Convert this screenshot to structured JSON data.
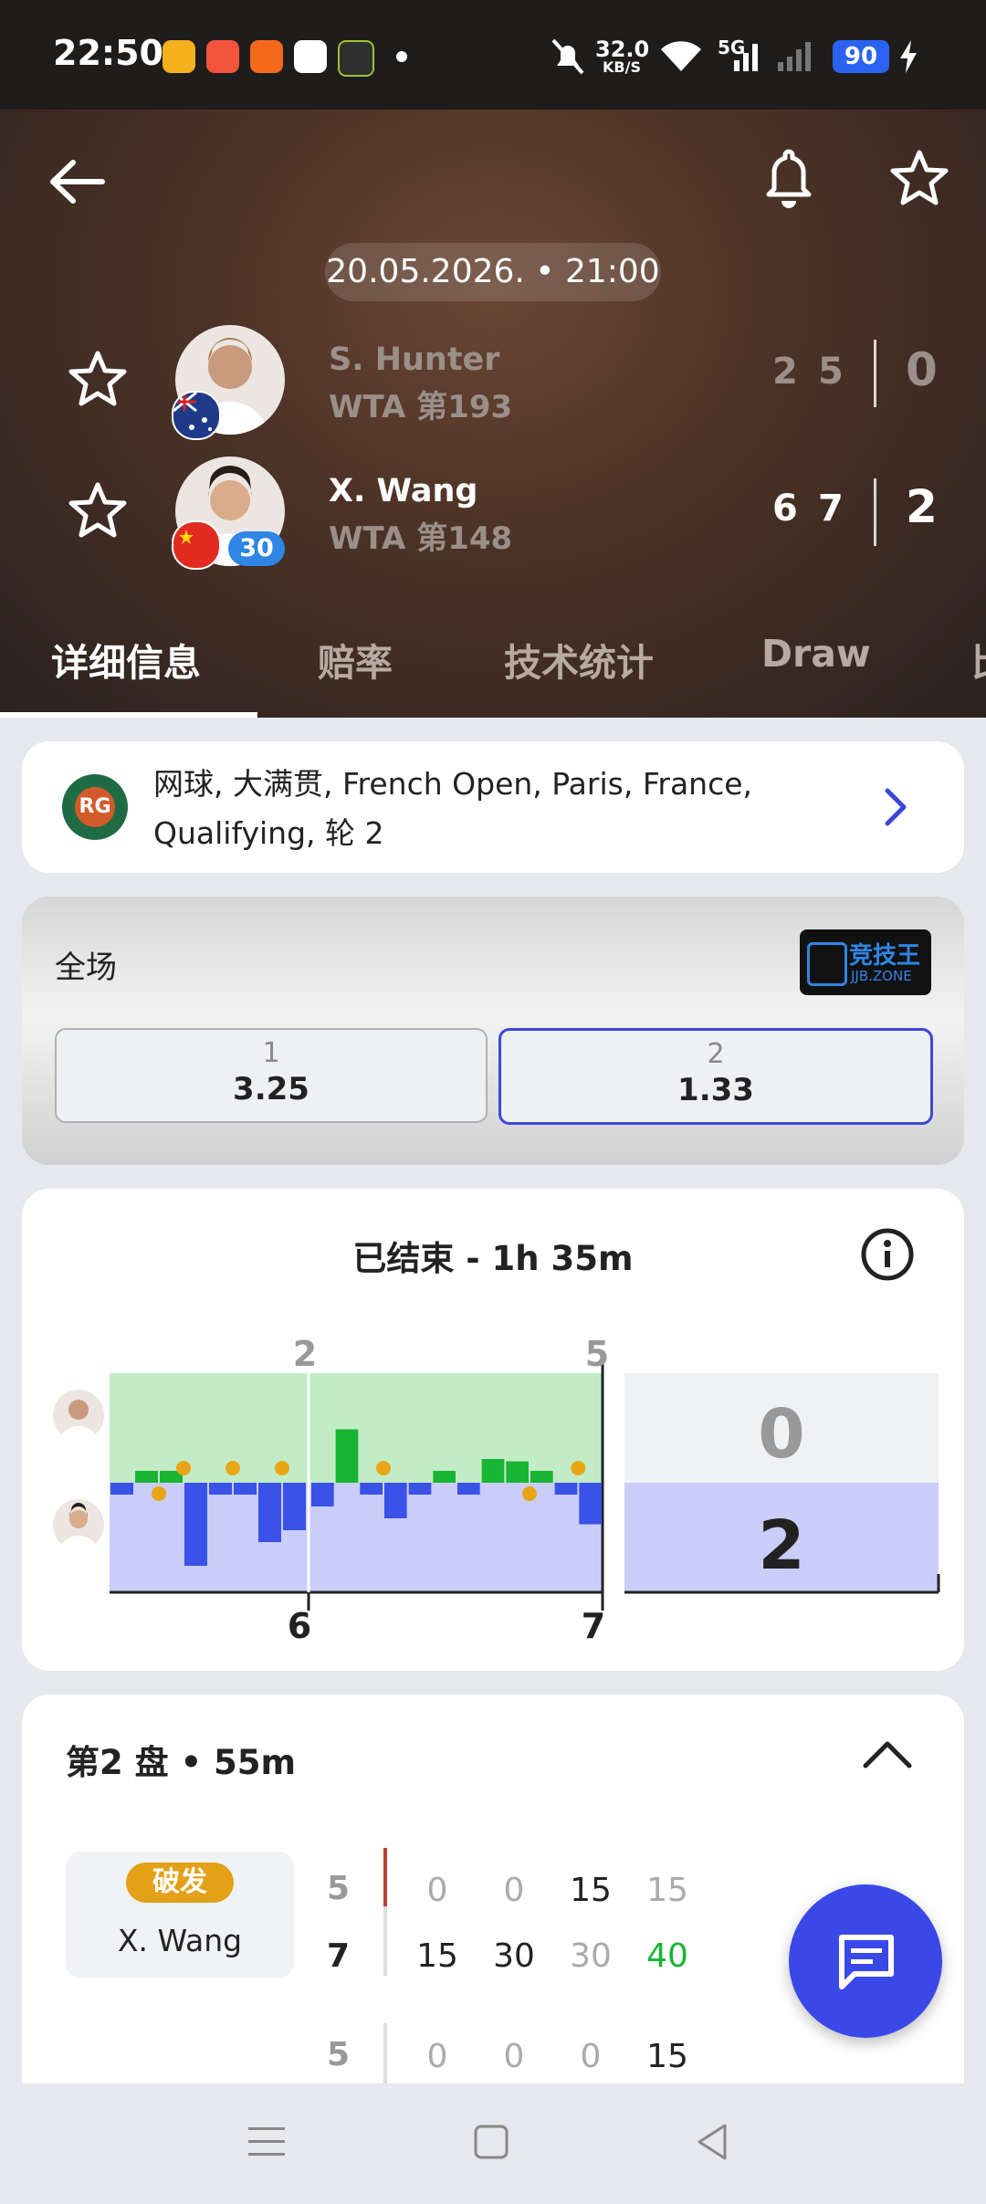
{
  "status_bar": {
    "time": "22:50",
    "net_speed_value": "32.0",
    "net_speed_unit": "KB/S",
    "network": "5G",
    "battery": "90",
    "app_icons": [
      "weibo-icon",
      "app-icon-2",
      "taobao-icon",
      "oppo-icon",
      "app-icon-5"
    ]
  },
  "header": {
    "datetime": "20.05.2026. • 21:00",
    "player1": {
      "name": "S. Hunter",
      "rank": "WTA 第193",
      "games": [
        "2",
        "5"
      ],
      "sets": "0",
      "country_flag": "australia-flag"
    },
    "player2": {
      "name": "X. Wang",
      "rank": "WTA 第148",
      "games": [
        "6",
        "7"
      ],
      "sets": "2",
      "seed": "30",
      "country_flag": "china-flag"
    }
  },
  "tabs": [
    "详细信息",
    "赔率",
    "技术统计",
    "Draw",
    "比"
  ],
  "active_tab": 0,
  "tournament": {
    "line1": "网球, 大满贯, French Open, Paris, France,",
    "line2": "Qualifying, 轮 2",
    "logo_text": "ROLAND GARROS"
  },
  "odds": {
    "title": "全场",
    "sponsor": "竞技王",
    "sponsor_sub": "JJB.ZONE",
    "options": [
      {
        "label": "1",
        "value": "3.25"
      },
      {
        "label": "2",
        "value": "1.33"
      }
    ]
  },
  "momentum": {
    "status": "已结束 - 1h 35m",
    "top_set_scores": [
      "2",
      "5"
    ],
    "bottom_set_scores": [
      "6",
      "7"
    ],
    "final_top": "0",
    "final_bottom": "2",
    "colors": {
      "top_area": "#c2ecc6",
      "bottom_area": "#c9cdf7",
      "top_bar": "#18b534",
      "bottom_bar": "#3a52e8",
      "break_dot": "#e8a617"
    },
    "set1_bars": [
      -1,
      1,
      1,
      -7,
      -1,
      -1,
      -5,
      -4
    ],
    "set2_bars": [
      -2,
      4.5,
      -1,
      -3,
      -1,
      1,
      -1,
      2,
      1.8,
      1,
      -1,
      -3.5
    ],
    "set1_breaks": [
      {
        "index": 2,
        "side": "down"
      },
      {
        "index": 3,
        "side": "up"
      },
      {
        "index": 5,
        "side": "up"
      },
      {
        "index": 7,
        "side": "up"
      }
    ],
    "set2_breaks": [
      {
        "index": 3,
        "side": "up"
      },
      {
        "index": 9,
        "side": "down"
      },
      {
        "index": 11,
        "side": "up"
      }
    ]
  },
  "set_detail": {
    "title": "第2 盘 • 55m",
    "event_badge": "破发",
    "player": "X. Wang",
    "row1": {
      "games_top": "5",
      "games_bottom": "7",
      "points_top": [
        "0",
        "0",
        "15",
        "15"
      ],
      "points_bottom": [
        "15",
        "30",
        "30",
        "40"
      ]
    },
    "row2": {
      "games_top": "5",
      "points_top": [
        "0",
        "0",
        "0",
        "15"
      ]
    }
  },
  "nav": [
    "menu-icon",
    "home-icon",
    "back-icon"
  ]
}
